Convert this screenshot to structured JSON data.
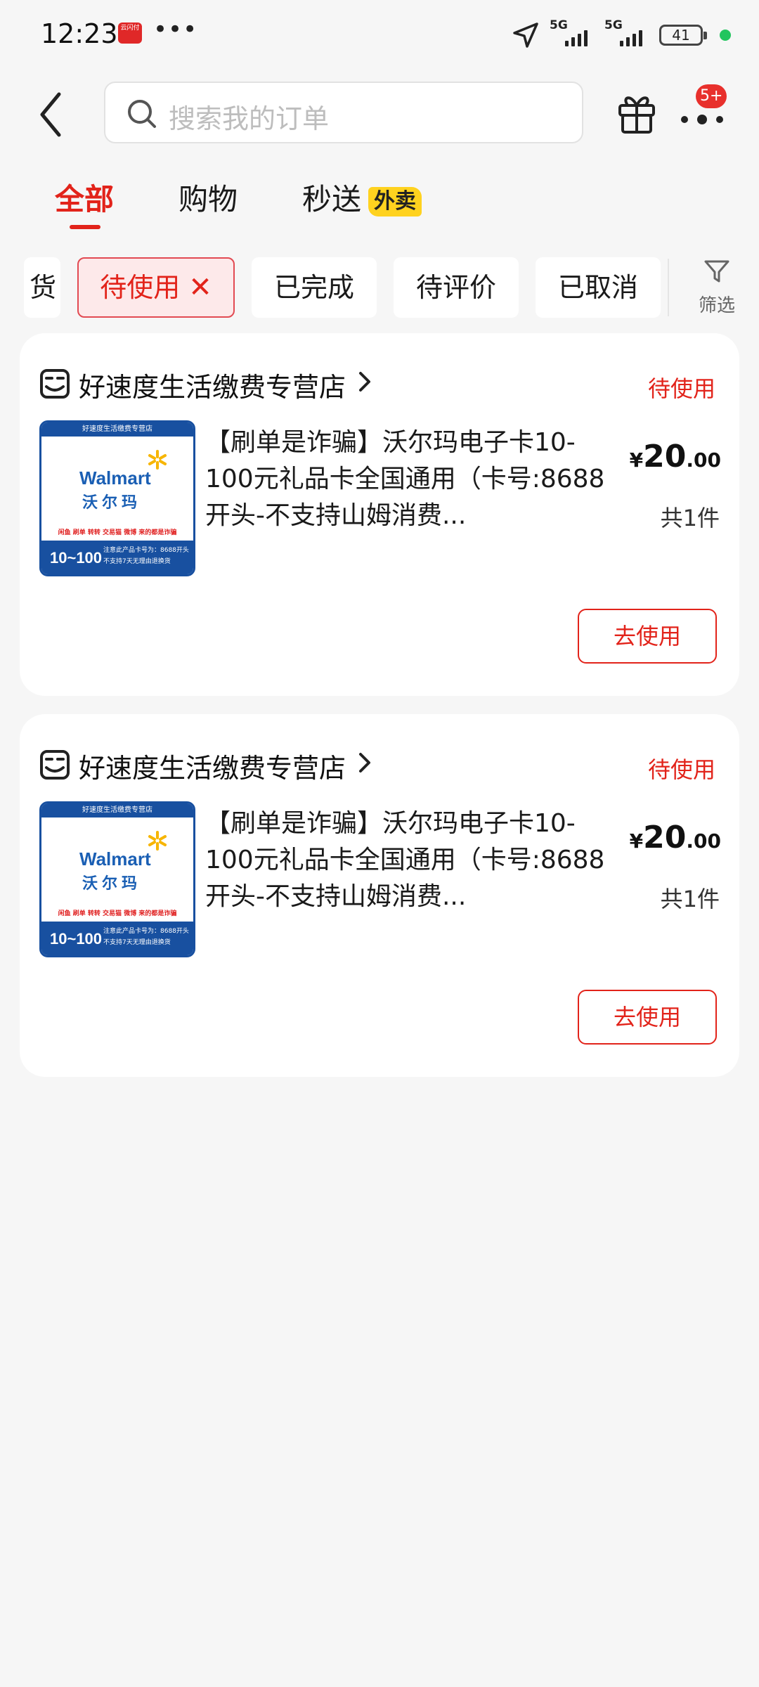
{
  "status_bar": {
    "time": "12:23",
    "app_badge_text": "云闪付",
    "more": "•••",
    "network": [
      "5G",
      "5G"
    ],
    "battery": "41"
  },
  "header": {
    "search_placeholder": "搜索我的订单",
    "more_badge": "5+"
  },
  "tabs": [
    {
      "label": "全部",
      "active": true
    },
    {
      "label": "购物",
      "active": false
    },
    {
      "label": "秒送",
      "active": false,
      "tag": "外卖"
    }
  ],
  "filters": {
    "chips": [
      {
        "label": "货",
        "cut": true
      },
      {
        "label": "待使用",
        "selected": true
      },
      {
        "label": "已完成"
      },
      {
        "label": "待评价"
      },
      {
        "label": "已取消"
      }
    ],
    "close_glyph": "✕",
    "filter_label": "筛选"
  },
  "orders": [
    {
      "store": "好速度生活缴费专营店",
      "status": "待使用",
      "image": {
        "top": "好速度生活缴费专营店",
        "brand_en": "Walmart",
        "brand_cn": "沃尔玛",
        "warning": "闲鱼 刷单 转转 交易猫 微博 来的都是诈骗",
        "range": "10~100",
        "note": "注意此产品卡号为：8688开头 不支持7天无理由退换货"
      },
      "title": "【刷单是诈骗】沃尔玛电子卡10-100元礼品卡全国通用（卡号:8688开头-不支持山姆消费...",
      "price_symbol": "¥",
      "price_int": "20",
      "price_dec": ".00",
      "quantity": "共1件",
      "action": "去使用"
    },
    {
      "store": "好速度生活缴费专营店",
      "status": "待使用",
      "image": {
        "top": "好速度生活缴费专营店",
        "brand_en": "Walmart",
        "brand_cn": "沃尔玛",
        "warning": "闲鱼 刷单 转转 交易猫 微博 来的都是诈骗",
        "range": "10~100",
        "note": "注意此产品卡号为：8688开头 不支持7天无理由退换货"
      },
      "title": "【刷单是诈骗】沃尔玛电子卡10-100元礼品卡全国通用（卡号:8688开头-不支持山姆消费...",
      "price_symbol": "¥",
      "price_int": "20",
      "price_dec": ".00",
      "quantity": "共1件",
      "action": "去使用"
    }
  ],
  "colors": {
    "accent": "#e2231a",
    "background": "#f6f6f6",
    "tag_yellow": "#ffd21f",
    "walmart_blue": "#1850a0"
  }
}
